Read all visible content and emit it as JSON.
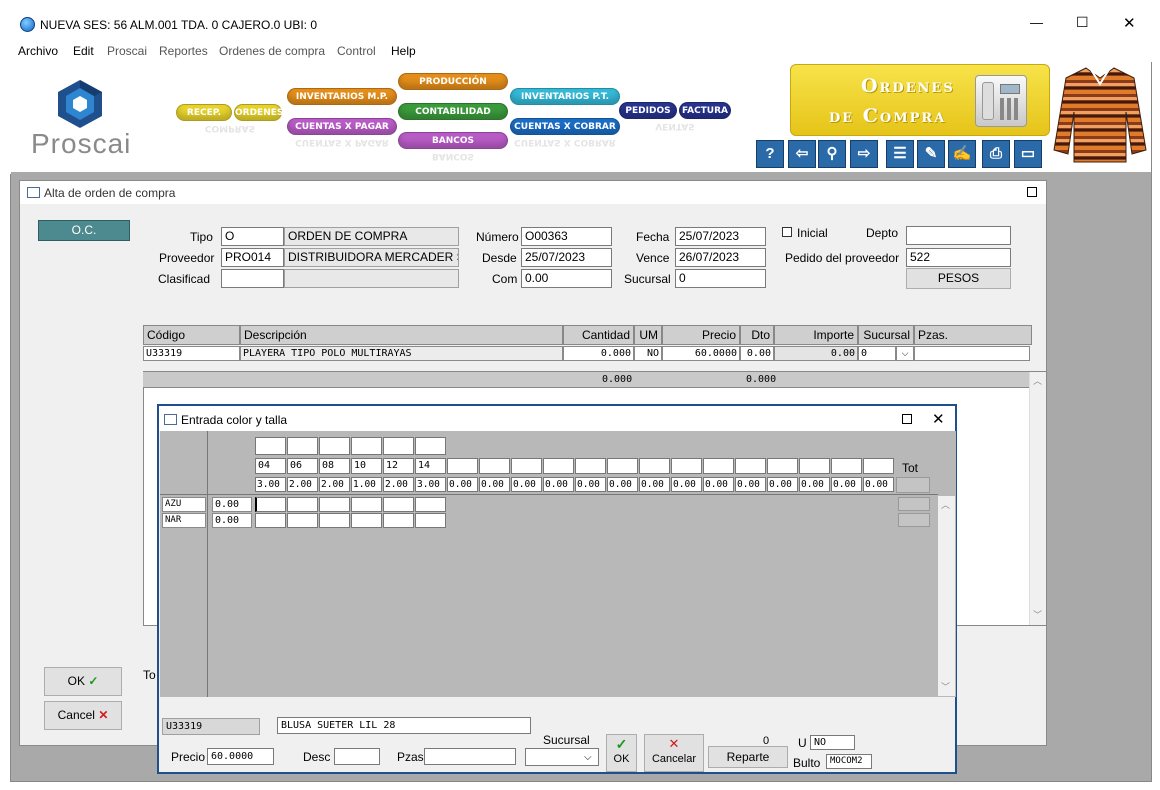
{
  "window": {
    "title": "NUEVA  SES: 56  ALM.001  TDA. 0  CAJERO.0  UBI: 0",
    "minimize": "—",
    "maximize": "☐",
    "close": "✕"
  },
  "menu": [
    "Archivo",
    "Edit",
    "Proscai",
    "Reportes",
    "Ordenes de compra",
    "Control",
    "Help"
  ],
  "logo_text": "Proscai",
  "modules": {
    "recep": "RECEP.",
    "ordenes": "ORDENES",
    "inventarios_mp": "INVENTARIOS M.P.",
    "cuentas_x_pagar": "CUENTAS X PAGAR",
    "produccion": "PRODUCCIÓN",
    "contabilidad": "CONTABILIDAD",
    "bancos": "BANCOS",
    "inventarios_pt": "INVENTARIOS P.T.",
    "cuentas_x_cobrar": "CUENTAS X COBRAR",
    "pedidos": "PEDIDOS",
    "factura": "FACTURA"
  },
  "banner": {
    "line1": "Ordenes",
    "line2": "de Compra"
  },
  "tool_icons": [
    "help-icon",
    "back-arrow-icon",
    "search-icon",
    "forward-arrow-icon",
    "list-icon",
    "edit-list-icon",
    "edit-icon",
    "print-icon",
    "window-icon"
  ],
  "form": {
    "title": "Alta de orden de compra",
    "badge": "O.C.",
    "tipo_label": "Tipo",
    "tipo_code": "O",
    "tipo_desc": "ORDEN DE COMPRA",
    "proveedor_label": "Proveedor",
    "proveedor_code": "PRO014",
    "proveedor_name": "DISTRIBUIDORA MERCADER S.A.",
    "clasificad_label": "Clasificad",
    "numero_label": "Número",
    "numero": "O00363",
    "desde_label": "Desde",
    "desde": "25/07/2023",
    "com_label": "Com",
    "com": "0.00",
    "fecha_label": "Fecha",
    "fecha": "25/07/2023",
    "vence_label": "Vence",
    "vence": "26/07/2023",
    "sucursal_label": "Sucursal",
    "sucursal": "0",
    "inicial_label": "Inicial",
    "depto_label": "Depto",
    "pedido_label": "Pedido del proveedor",
    "pedido": "522",
    "currency_button": "PESOS",
    "ok_label": "OK",
    "cancel_label": "Cancel",
    "tot_label": "To"
  },
  "grid": {
    "headers": [
      "Código",
      "Descripción",
      "Cantidad",
      "UM",
      "Precio",
      "Dto",
      "Importe",
      "Sucursal",
      "Pzas."
    ],
    "row": {
      "codigo": "U33319",
      "descripcion": "PLAYERA TIPO POLO MULTIRAYAS",
      "cantidad": "0.000",
      "um": "NO",
      "precio": "60.0000",
      "dto": "0.00",
      "importe": "0.00",
      "sucursal": "0"
    },
    "totals": {
      "cantidad": "0.000",
      "dto": "0.000"
    }
  },
  "dialog": {
    "title": "Entrada color y talla",
    "tot_label": "Tot",
    "sizes": [
      "04",
      "06",
      "08",
      "10",
      "12",
      "14"
    ],
    "size_qty": [
      "3.00",
      "2.00",
      "2.00",
      "1.00",
      "2.00",
      "3.00",
      "0.00",
      "0.00",
      "0.00",
      "0.00",
      "0.00",
      "0.00",
      "0.00",
      "0.00",
      "0.00",
      "0.00",
      "0.00",
      "0.00",
      "0.00",
      "0.00"
    ],
    "colors": [
      {
        "code": "AZU",
        "total": "0.00"
      },
      {
        "code": "NAR",
        "total": "0.00"
      }
    ],
    "product_code": "U33319",
    "product_desc": "BLUSA SUETER LIL 28",
    "precio_label": "Precio",
    "precio": "60.0000",
    "desc_label": "Desc",
    "pzas_label": "Pzas",
    "sucursal_label": "Sucursal",
    "ok_label": "OK",
    "cancel_label": "Cancelar",
    "count": "0",
    "reparte_label": "Reparte",
    "u_label": "U",
    "u_value": "NO",
    "bulto_label": "Bulto",
    "bulto_value": "MOCOM2"
  }
}
